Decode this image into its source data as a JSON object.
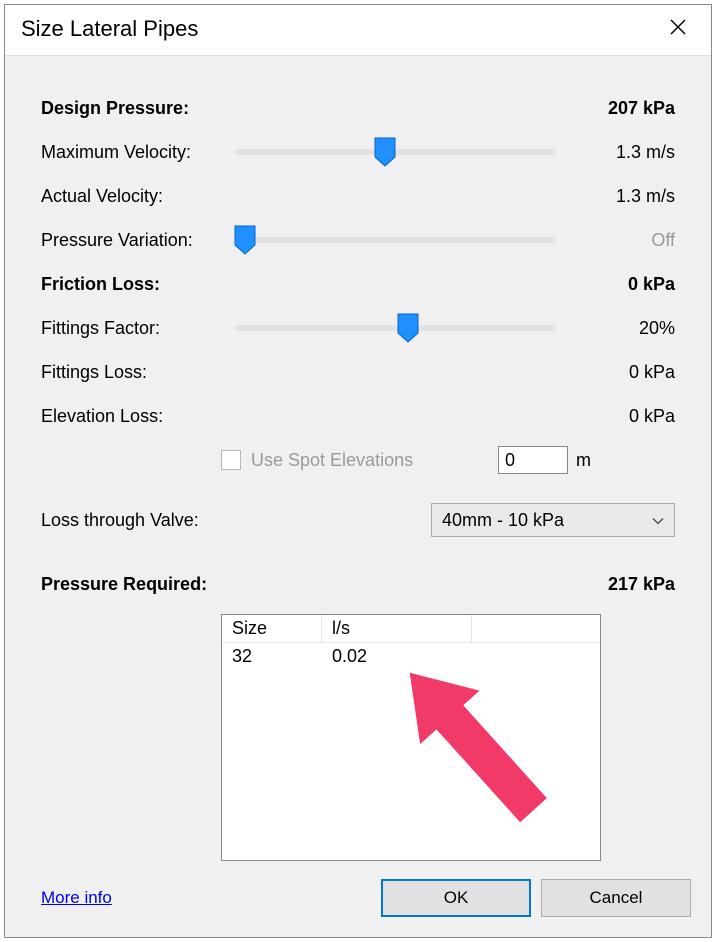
{
  "title": "Size Lateral Pipes",
  "designPressure": {
    "label": "Design Pressure:",
    "value": "207 kPa"
  },
  "maxVelocity": {
    "label": "Maximum Velocity:",
    "value": "1.3 m/s",
    "sliderPct": 47
  },
  "actualVelocity": {
    "label": "Actual Velocity:",
    "value": "1.3 m/s"
  },
  "pressureVariation": {
    "label": "Pressure Variation:",
    "value": "Off",
    "sliderPct": 3
  },
  "frictionLoss": {
    "label": "Friction Loss:",
    "value": "0 kPa"
  },
  "fittingsFactor": {
    "label": "Fittings Factor:",
    "value": "20%",
    "sliderPct": 54
  },
  "fittingsLoss": {
    "label": "Fittings Loss:",
    "value": "0 kPa"
  },
  "elevationLoss": {
    "label": "Elevation Loss:",
    "value": "0 kPa"
  },
  "spotElevations": {
    "label": "Use Spot Elevations",
    "inputValue": "0",
    "unit": "m"
  },
  "lossThroughValve": {
    "label": "Loss through Valve:",
    "selected": "40mm - 10 kPa"
  },
  "pressureRequired": {
    "label": "Pressure Required:",
    "value": "217 kPa"
  },
  "table": {
    "headers": [
      "Size",
      "l/s"
    ],
    "rows": [
      [
        "32",
        "0.02"
      ]
    ]
  },
  "footer": {
    "moreInfo": "More info",
    "ok": "OK",
    "cancel": "Cancel"
  }
}
